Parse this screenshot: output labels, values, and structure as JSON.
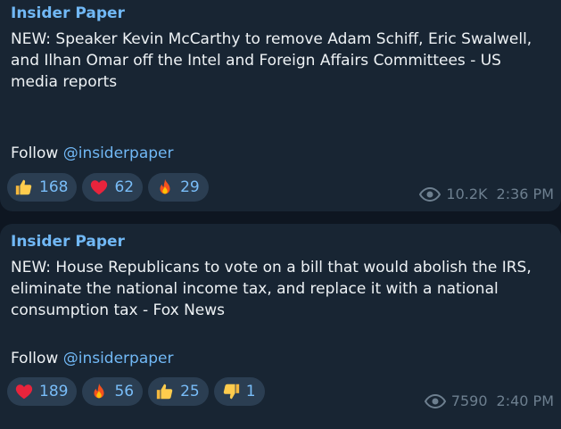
{
  "messages": [
    {
      "sender": "Insider Paper",
      "text": "NEW: Speaker Kevin McCarthy to remove Adam Schiff, Eric Swalwell, and Ilhan Omar off the Intel and Foreign Affairs Committees - US media reports",
      "follow_text": "Follow ",
      "follow_link": "@insiderpaper",
      "reactions": [
        {
          "emoji": "thumbs-up",
          "count": "168"
        },
        {
          "emoji": "red-heart",
          "count": "62"
        },
        {
          "emoji": "fire",
          "count": "29"
        }
      ],
      "views": "10.2K",
      "time": "2:36 PM"
    },
    {
      "sender": "Insider Paper",
      "text": "NEW: House Republicans to vote on a bill that would abolish the IRS, eliminate the national income tax, and replace it with a national consumption tax - Fox News",
      "follow_text": "Follow ",
      "follow_link": "@insiderpaper",
      "reactions": [
        {
          "emoji": "red-heart",
          "count": "189"
        },
        {
          "emoji": "fire",
          "count": "56"
        },
        {
          "emoji": "thumbs-up",
          "count": "25"
        },
        {
          "emoji": "thumbs-down",
          "count": "1"
        }
      ],
      "views": "7590",
      "time": "2:40 PM"
    }
  ],
  "colors": {
    "background": "#0e1621",
    "bubble": "#182533",
    "accent": "#71b8f5",
    "reaction_bg": "#2b3e52",
    "meta": "#6d7f8f"
  }
}
